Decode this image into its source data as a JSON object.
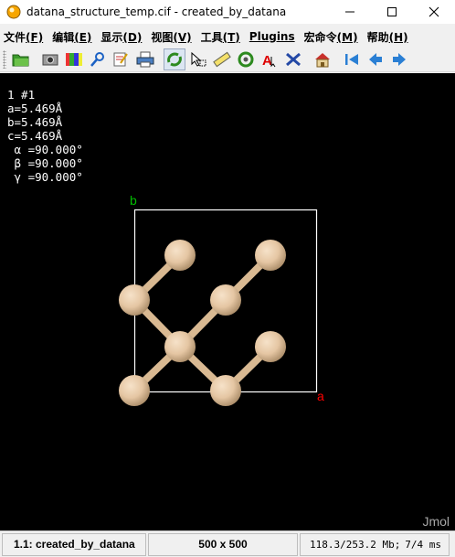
{
  "window": {
    "title": "datana_structure_temp.cif - created_by_datana",
    "minimize_icon": "minimize-icon",
    "maximize_icon": "maximize-icon",
    "close_icon": "close-icon"
  },
  "menu": {
    "items": [
      {
        "label": "文件",
        "key": "(F)"
      },
      {
        "label": "编辑",
        "key": "(E)"
      },
      {
        "label": "显示",
        "key": "(D)"
      },
      {
        "label": "视图",
        "key": "(V)"
      },
      {
        "label": "工具",
        "key": "(T)"
      },
      {
        "label": "Plugins",
        "key": ""
      },
      {
        "label": "宏命令",
        "key": "(M)"
      },
      {
        "label": "帮助",
        "key": "(H)"
      }
    ]
  },
  "toolbar": {
    "buttons": [
      "open-icon",
      "screenshot-icon",
      "color-icon",
      "pipette-icon",
      "edit-icon",
      "print-icon",
      "rotate-icon",
      "pick-icon",
      "measure-icon",
      "spin-icon",
      "label-icon",
      "modelkit-icon",
      "home-icon",
      "first-frame-icon",
      "prev-frame-icon",
      "next-frame-icon"
    ],
    "pressed": "rotate-icon"
  },
  "viewer": {
    "info_lines": [
      "1 #1",
      "a=5.469Å",
      "b=5.469Å",
      "c=5.469Å",
      " α =90.000°",
      " β =90.000°",
      " γ =90.000°"
    ],
    "axis_a_label": "a",
    "axis_b_label": "b",
    "watermark": "Jmol",
    "atom_color": "#e5c6a3",
    "axis_a_color": "#ff0000",
    "axis_b_color": "#00bb00",
    "background": "#000000"
  },
  "status": {
    "model": "1.1: created_by_datana",
    "size": "500 x 500",
    "memory": "118.3/253.2 Mb;",
    "timing": "7/4 ms"
  }
}
